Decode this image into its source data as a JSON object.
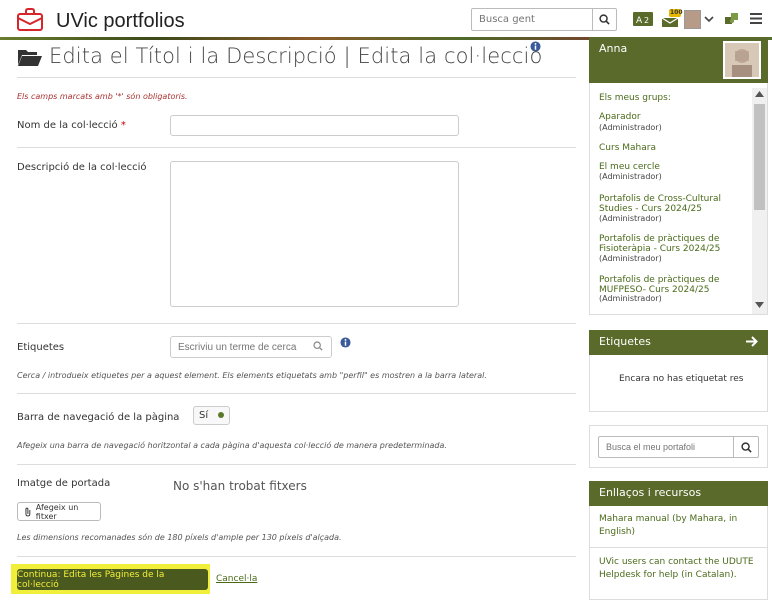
{
  "header": {
    "site_title": "UVic portfolios",
    "search_placeholder": "Busca gent",
    "notification_count": "100",
    "language_label": "A",
    "colors": {
      "accent": "#5a6a2a",
      "logo": "#d6262b",
      "highlight": "#f2ef3a"
    }
  },
  "page": {
    "title": "Edita el Títol i la Descripció | Edita la col·lecció",
    "required_note": "Els camps marcats amb '*' són obligatoris.",
    "collection_name_label": "Nom de la col·lecció",
    "required_star": "*",
    "description_label": "Descripció de la col·lecció",
    "tags_label": "Etiquetes",
    "tags_placeholder": "Escriviu un terme de cerca",
    "tags_hint": "Cerca / introdueix etiquetes per a aquest element. Els elements etiquetats amb \"perfil\" es mostren a la barra lateral.",
    "nav_label": "Barra de navegació de la pàgina",
    "nav_toggle": "Sí",
    "nav_hint": "Afegeix una barra de navegació horitzontal a cada pàgina d'aquesta col·lecció de manera predeterminada.",
    "cover_label": "Imatge de portada",
    "no_files": "No s'han trobat fitxers",
    "add_file_button": "Afegeix un fitxer",
    "cover_hint": "Les dimensions recomanades són de 180 píxels d'ample per 130 píxels d'alçada.",
    "continue_button": "Continua: Edita les Pàgines de la col·lecció",
    "cancel_link": "Cancel·la"
  },
  "sidebar": {
    "user_name": "Anna",
    "groups_heading": "Els meus grups:",
    "groups": [
      {
        "name": "Aparador",
        "role": "(Administrador)"
      },
      {
        "name": "Curs Mahara",
        "role": ""
      },
      {
        "name": "El meu cercle",
        "role": "(Administrador)"
      },
      {
        "name": "Portafolis de Cross-Cultural Studies - Curs 2024/25",
        "role": "(Administrador)"
      },
      {
        "name": "Portafolis de pràctiques de Fisioteràpia - Curs 2024/25",
        "role": "(Administrador)"
      },
      {
        "name": "Portafolis de pràctiques de MUFPESO- Curs 2024/25",
        "role": "(Administrador)"
      }
    ],
    "tags_panel_title": "Etiquetes",
    "tags_panel_text": "Encara no has etiquetat res",
    "portfolio_search_placeholder": "Busca el meu portafoli",
    "links_panel_title": "Enllaços i recursos",
    "links": [
      "Mahara manual (by Mahara, in English)",
      "UVic users can contact the UDUTE Helpdesk for help (in Catalan)."
    ]
  }
}
